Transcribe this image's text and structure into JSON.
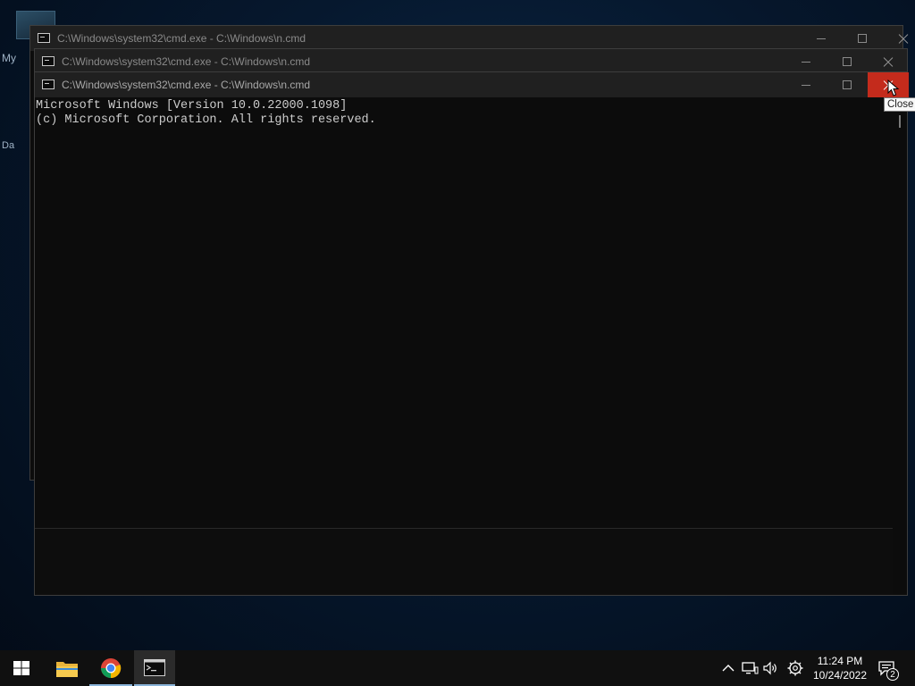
{
  "desktop": {
    "icon_text_1": "My",
    "icon_text_2": "Da"
  },
  "windows": [
    {
      "title": "C:\\Windows\\system32\\cmd.exe - C:\\Windows\\n.cmd"
    },
    {
      "title": "C:\\Windows\\system32\\cmd.exe - C:\\Windows\\n.cmd"
    },
    {
      "title": "C:\\Windows\\system32\\cmd.exe - C:\\Windows\\n.cmd"
    }
  ],
  "console": {
    "line1": "Microsoft Windows [Version 10.0.22000.1098]",
    "line2": "(c) Microsoft Corporation. All rights reserved."
  },
  "tooltip": "Close",
  "taskbar": {
    "items": [
      "start-icon",
      "file-explorer-icon",
      "chrome-icon",
      "command-prompt-icon"
    ],
    "time": "11:24 PM",
    "date": "10/24/2022",
    "notification_count": "2"
  },
  "colors": {
    "close_hover": "#c42b1c",
    "titlebar": "#202020",
    "console_bg": "#0c0c0c",
    "console_text": "#cccccc"
  }
}
